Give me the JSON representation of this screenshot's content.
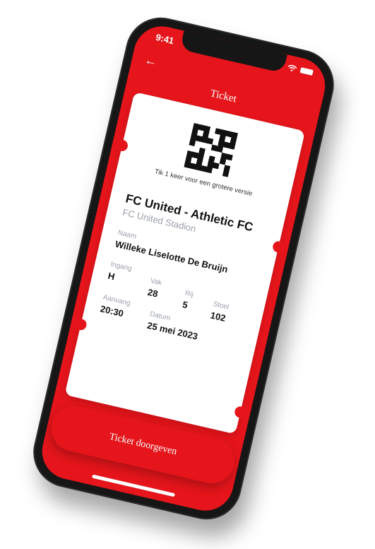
{
  "status": {
    "time": "9:41"
  },
  "nav": {
    "title": "Ticket"
  },
  "ticket": {
    "qr_hint": "Tik 1 keer voor een grotere versie",
    "match": "FC United - Athletic FC",
    "stadium": "FC United Stadion",
    "name_label": "Naam",
    "name_value": "Willeke Liselotte De Bruijn",
    "entrance_label": "Ingang",
    "entrance_value": "H",
    "section_label": "Vak",
    "section_value": "28",
    "row_label": "Rij",
    "row_value": "5",
    "seat_label": "Stoel",
    "seat_value": "102",
    "start_label": "Aanvang",
    "start_value": "20:30",
    "date_label": "Datum",
    "date_value": "25 mei 2023"
  },
  "cta": {
    "label": "Ticket doorgeven"
  },
  "colors": {
    "brand_red": "#e5151b",
    "text_dark": "#111111",
    "text_muted": "#9a9fa8"
  },
  "icons": [
    "back-arrow-icon",
    "wifi-icon",
    "battery-icon",
    "qr-code-icon"
  ]
}
